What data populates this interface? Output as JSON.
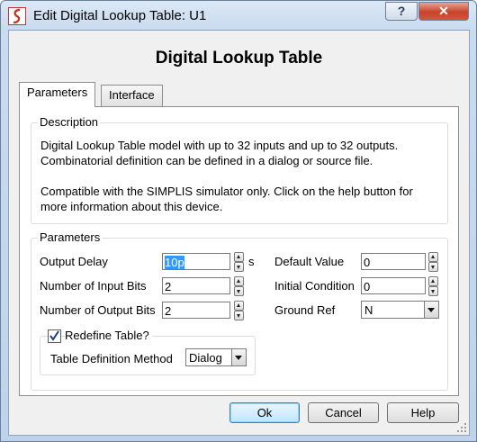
{
  "window": {
    "title": "Edit Digital Lookup Table: U1",
    "help_glyph": "?",
    "close_glyph": "✕"
  },
  "dialog": {
    "heading": "Digital Lookup Table"
  },
  "tabs": [
    {
      "label": "Parameters",
      "active": true
    },
    {
      "label": "Interface",
      "active": false
    }
  ],
  "description": {
    "legend": "Description",
    "lines": [
      "Digital Lookup Table model with up to 32 inputs and up to 32 outputs.",
      "Combinatorial definition can be defined in a dialog or source file.",
      "",
      "Compatible with the SIMPLIS simulator only. Click on the help button for",
      "more information about this device."
    ]
  },
  "parameters": {
    "legend": "Parameters",
    "output_delay": {
      "label": "Output Delay",
      "value": "10p",
      "unit": "s"
    },
    "input_bits": {
      "label": "Number of Input Bits",
      "value": "2"
    },
    "output_bits": {
      "label": "Number of Output Bits",
      "value": "2"
    },
    "default_value": {
      "label": "Default Value",
      "value": "0"
    },
    "initial_condition": {
      "label": "Initial Condition",
      "value": "0"
    },
    "ground_ref": {
      "label": "Ground Ref",
      "value": "N"
    }
  },
  "redefine": {
    "label": "Redefine Table?",
    "checked": true,
    "method_label": "Table Definition Method",
    "method_value": "Dialog"
  },
  "buttons": {
    "ok": "Ok",
    "cancel": "Cancel",
    "help": "Help"
  }
}
